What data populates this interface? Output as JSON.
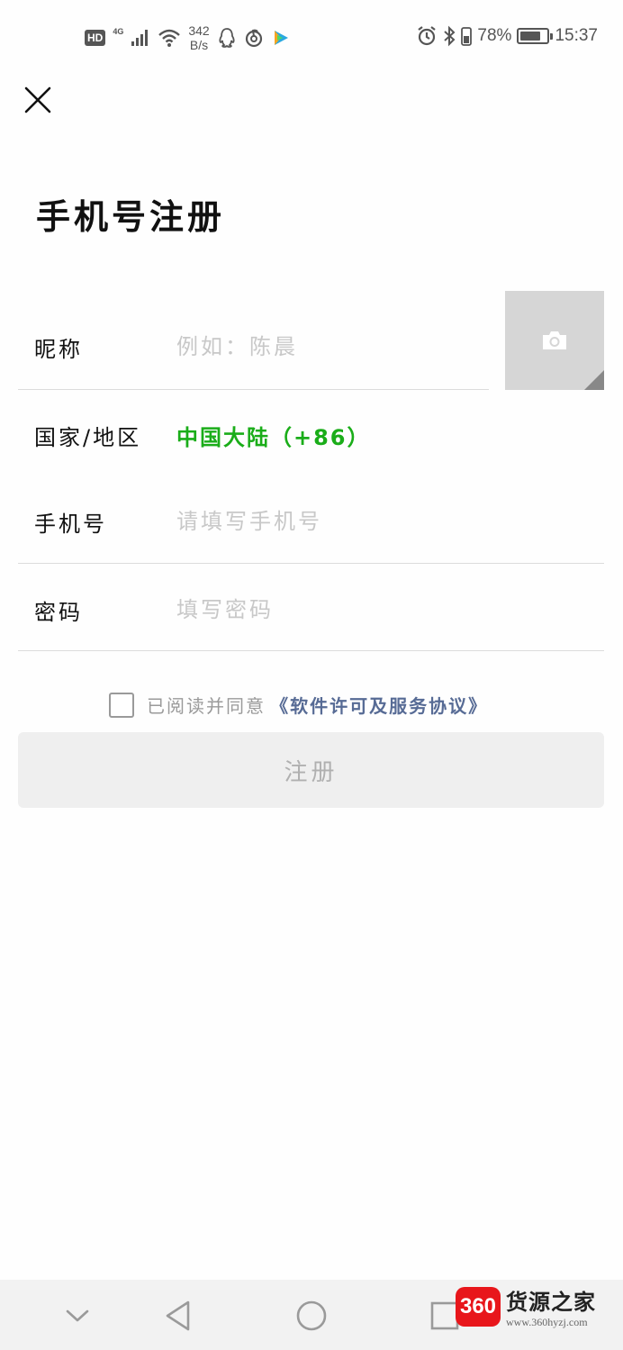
{
  "status_bar": {
    "hd": "HD",
    "network": "4G",
    "speed_value": "342",
    "speed_unit": "B/s",
    "battery_percent": "78%",
    "battery_level": 0.78,
    "time": "15:37"
  },
  "header": {
    "close_icon": "close-icon",
    "title": "手机号注册"
  },
  "form": {
    "nickname": {
      "label": "昵称",
      "placeholder": "例如：陈晨"
    },
    "avatar_icon": "camera-icon",
    "region": {
      "label": "国家/地区",
      "value": "中国大陆（+86）"
    },
    "phone": {
      "label": "手机号",
      "placeholder": "请填写手机号"
    },
    "password": {
      "label": "密码",
      "placeholder": "填写密码"
    }
  },
  "agreement": {
    "checked": false,
    "text": "已阅读并同意",
    "link": "《软件许可及服务协议》"
  },
  "register_button": "注册",
  "nav_bar": {
    "items": [
      "chevron-down-icon",
      "back-triangle-icon",
      "home-circle-icon",
      "recents-square-icon"
    ]
  },
  "watermark": {
    "badge": "360",
    "name": "货源之家",
    "url": "www.360hyzj.com"
  },
  "colors": {
    "accent_green": "#1aad19",
    "link_blue": "#576b95",
    "placeholder_gray": "#c8c8c8"
  }
}
